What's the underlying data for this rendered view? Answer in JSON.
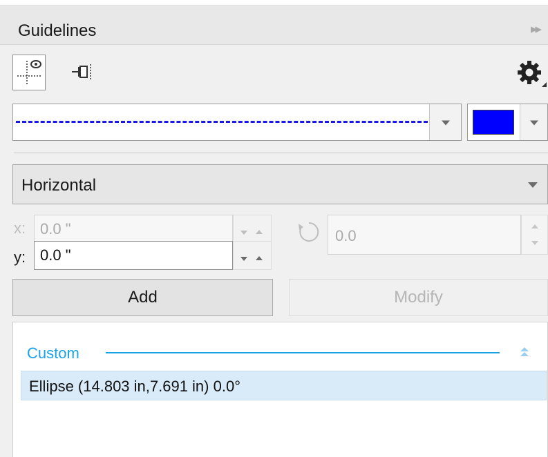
{
  "panel": {
    "title": "Guidelines",
    "expand_icon": "panel-expand-icon"
  },
  "toolbar": {
    "icons": [
      "guideline-preview-icon",
      "snap-to-guideline-icon",
      "gear-icon"
    ]
  },
  "line_style": {
    "pattern": "dashed",
    "color": "#1a1ae6"
  },
  "guide_color": {
    "value": "#0000ff"
  },
  "guide_type": {
    "selected": "Horizontal"
  },
  "coordinates": {
    "x_label": "x:",
    "x_value": "0.0 \"",
    "y_label": "y:",
    "y_value": "0.0 \"",
    "angle_value": "0.0"
  },
  "buttons": {
    "add": "Add",
    "modify": "Modify"
  },
  "list": {
    "group": "Custom",
    "items": [
      {
        "text": "Ellipse (14.803 in,7.691 in) 0.0°"
      }
    ]
  },
  "colors": {
    "accent": "#1aa3e6",
    "selection": "#d9ebf9"
  }
}
